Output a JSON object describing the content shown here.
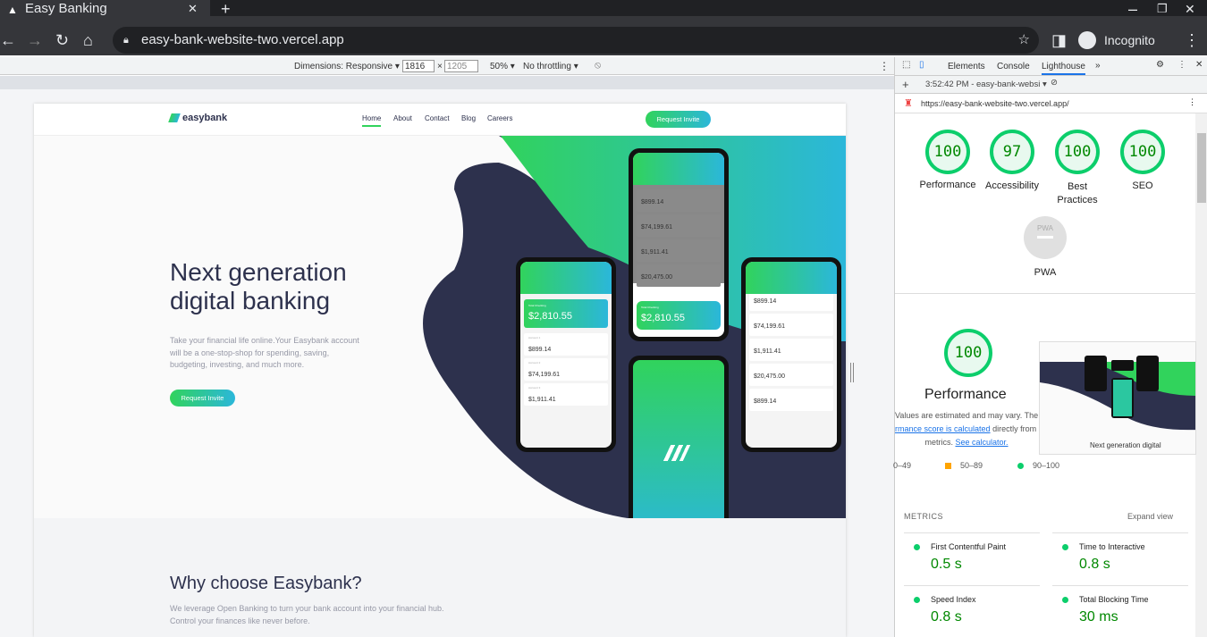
{
  "browser": {
    "tab_title": "Easy Banking",
    "url": "easy-bank-website-two.vercel.app",
    "profile": "Incognito"
  },
  "device_toolbar": {
    "dimensions": "Dimensions: Responsive ▾",
    "width": "1816",
    "height": "1205",
    "zoom": "50% ▾",
    "throttling": "No throttling ▾"
  },
  "site": {
    "logo": "easybank",
    "nav": [
      "Home",
      "About",
      "Contact",
      "Blog",
      "Careers"
    ],
    "cta": "Request Invite",
    "hero_title_1": "Next generation",
    "hero_title_2": "digital banking",
    "hero_text": "Take your financial life online.Your Easybank account will be a one-stop-shop for spending, saving, budgeting, investing, and much more.",
    "why_title": "Why choose Easybank?",
    "why_text": "We leverage Open Banking to turn your bank account into your financial hub. Control your finances like never before.",
    "phone_total": "$2,810.55",
    "accounts": [
      "$899.14",
      "$74,199.61",
      "$1,911.41",
      "$20,475.00",
      "$899.14"
    ]
  },
  "devtools": {
    "tabs": [
      "Elements",
      "Console",
      "Lighthouse"
    ],
    "active_tab": "Lighthouse",
    "report": "3:52:42 PM - easy-bank-websi ▾",
    "report_url": "https://easy-bank-website-two.vercel.app/",
    "scores": [
      {
        "label": "Performance",
        "value": "100"
      },
      {
        "label": "Accessibility",
        "value": "97"
      },
      {
        "label": "Best Practices",
        "value": "100"
      },
      {
        "label": "SEO",
        "value": "100"
      }
    ],
    "pwa": {
      "label": "PWA",
      "badge": "PWA"
    },
    "perf_title": "Performance",
    "perf_score": "100",
    "note_1": "Values are estimated and may vary. The",
    "note_link": "rmance score is calculated",
    "note_2": "directly from t",
    "note_3": "metrics.",
    "note_link2": "See calculator.",
    "screenshot_caption": "Next generation digital",
    "legend": [
      "0–49",
      "50–89",
      "90–100"
    ],
    "metrics_label": "METRICS",
    "expand": "Expand view",
    "metrics": [
      {
        "name": "First Contentful Paint",
        "value": "0.5 s"
      },
      {
        "name": "Time to Interactive",
        "value": "0.8 s"
      },
      {
        "name": "Speed Index",
        "value": "0.8 s"
      },
      {
        "name": "Total Blocking Time",
        "value": "30 ms"
      }
    ],
    "colors": {
      "pass": "#0cce6b",
      "average": "#ffa400",
      "accent": "#1a73e8"
    }
  }
}
